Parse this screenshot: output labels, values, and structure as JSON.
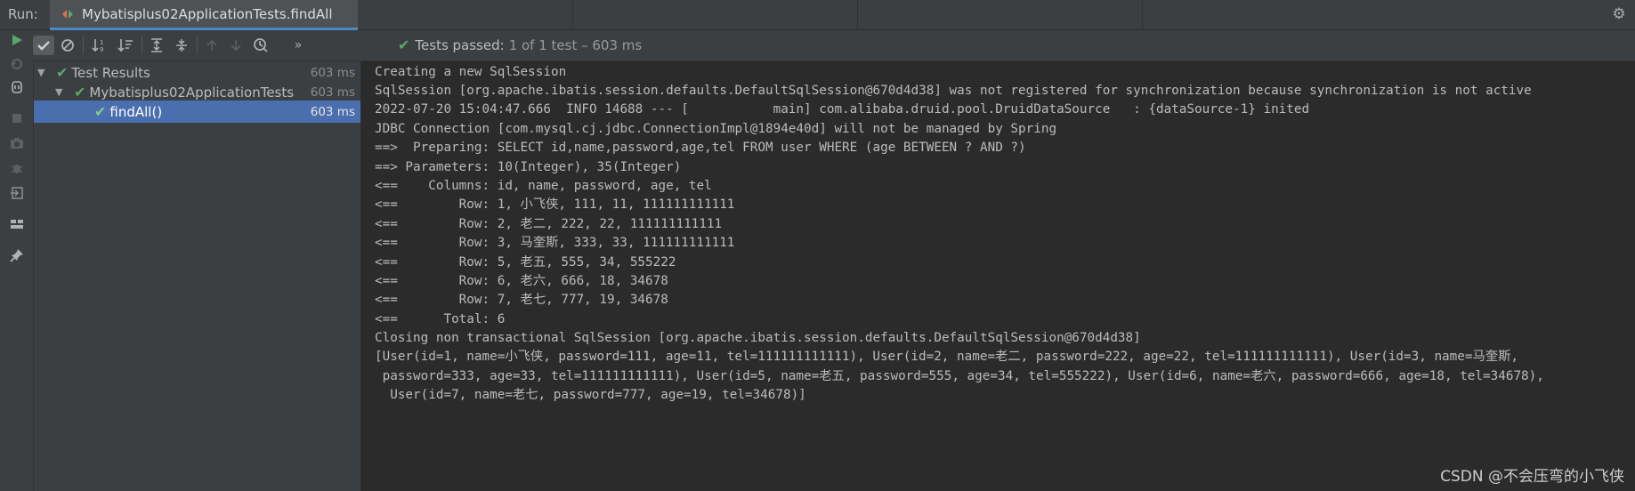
{
  "run_label": "Run:",
  "tab_title": "Mybatisplus02ApplicationTests.findAll",
  "status": {
    "passed_label": "Tests passed:",
    "count_text": "1 of 1 test – 603 ms"
  },
  "tree": [
    {
      "label": "Test Results",
      "time": "603 ms"
    },
    {
      "label": "Mybatisplus02ApplicationTests",
      "time": "603 ms"
    },
    {
      "label": "findAll()",
      "time": "603 ms"
    }
  ],
  "console_lines": [
    "Creating a new SqlSession",
    "SqlSession [org.apache.ibatis.session.defaults.DefaultSqlSession@670d4d38] was not registered for synchronization because synchronization is not active",
    "2022-07-20 15:04:47.666  INFO 14688 --- [           main] com.alibaba.druid.pool.DruidDataSource   : {dataSource-1} inited",
    "JDBC Connection [com.mysql.cj.jdbc.ConnectionImpl@1894e40d] will not be managed by Spring",
    "==>  Preparing: SELECT id,name,password,age,tel FROM user WHERE (age BETWEEN ? AND ?)",
    "==> Parameters: 10(Integer), 35(Integer)",
    "<==    Columns: id, name, password, age, tel",
    "<==        Row: 1, 小飞侠, 111, 11, 111111111111",
    "<==        Row: 2, 老二, 222, 22, 111111111111",
    "<==        Row: 3, 马奎斯, 333, 33, 111111111111",
    "<==        Row: 5, 老五, 555, 34, 555222",
    "<==        Row: 6, 老六, 666, 18, 34678",
    "<==        Row: 7, 老七, 777, 19, 34678",
    "<==      Total: 6",
    "Closing non transactional SqlSession [org.apache.ibatis.session.defaults.DefaultSqlSession@670d4d38]",
    "[User(id=1, name=小飞侠, password=111, age=11, tel=111111111111), User(id=2, name=老二, password=222, age=22, tel=111111111111), User(id=3, name=马奎斯,",
    " password=333, age=33, tel=111111111111), User(id=5, name=老五, password=555, age=34, tel=555222), User(id=6, name=老六, password=666, age=18, tel=34678),",
    "  User(id=7, name=老七, password=777, age=19, tel=34678)]"
  ],
  "watermark": "CSDN @不会压弯的小飞侠",
  "colors": {
    "pass_green": "#59a869",
    "selection": "#4b6eaf",
    "tab_underline": "#4a88c7"
  }
}
